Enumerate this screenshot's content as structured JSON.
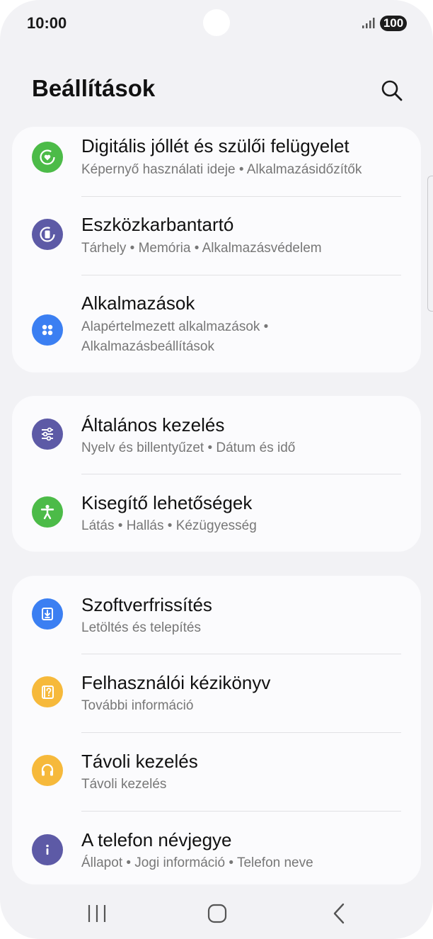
{
  "status_bar": {
    "time": "10:00",
    "battery": "100",
    "icons": [
      "signal-icon",
      "battery-icon"
    ]
  },
  "header": {
    "title": "Beállítások",
    "search_icon": "search-icon"
  },
  "groups": [
    {
      "items": [
        {
          "title": "Digitális jóllét és szülői felügyelet",
          "subtitle": "Képernyő használati ideje  •  Alkalmazásidőzítők",
          "icon": "digital-wellbeing-icon",
          "icon_color": "#4cbb48"
        },
        {
          "title": "Eszközkarbantartó",
          "subtitle": "Tárhely  •  Memória  •  Alkalmazásvédelem",
          "icon": "device-care-icon",
          "icon_color": "#5d5aa6"
        },
        {
          "title": "Alkalmazások",
          "subtitle": "Alapértelmezett alkalmazások  •  Alkalmazásbeállítások",
          "icon": "apps-icon",
          "icon_color": "#3b7ff2"
        }
      ]
    },
    {
      "items": [
        {
          "title": "Általános kezelés",
          "subtitle": "Nyelv és billentyűzet  •  Dátum és idő",
          "icon": "sliders-icon",
          "icon_color": "#5d5aa6"
        },
        {
          "title": "Kisegítő lehetőségek",
          "subtitle": "Látás  •  Hallás  •  Kézügyesség",
          "icon": "accessibility-icon",
          "icon_color": "#4cbb48"
        }
      ]
    },
    {
      "items": [
        {
          "title": "Szoftverfrissítés",
          "subtitle": "Letöltés és telepítés",
          "icon": "download-icon",
          "icon_color": "#3b7ff2"
        },
        {
          "title": "Felhasználói kézikönyv",
          "subtitle": "További információ",
          "icon": "help-book-icon",
          "icon_color": "#f6b93b"
        },
        {
          "title": "Távoli kezelés",
          "subtitle": "Távoli kezelés",
          "icon": "headset-icon",
          "icon_color": "#f6b93b"
        },
        {
          "title": "A telefon névjegye",
          "subtitle": "Állapot  •  Jogi információ  •  Telefon neve",
          "icon": "info-icon",
          "icon_color": "#5d5aa6"
        }
      ]
    }
  ],
  "nav_bar": {
    "buttons": [
      "recents-icon",
      "home-icon",
      "back-icon"
    ]
  }
}
